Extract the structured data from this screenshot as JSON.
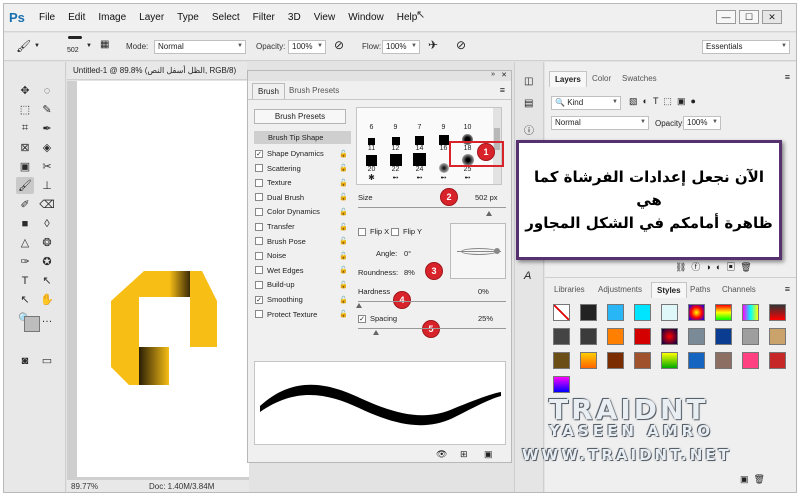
{
  "menubar": {
    "logo": "Ps",
    "items": [
      "File",
      "Edit",
      "Image",
      "Layer",
      "Type",
      "Select",
      "Filter",
      "3D",
      "View",
      "Window",
      "Help"
    ],
    "window_controls": {
      "minimize": "—",
      "restore": "☐",
      "close": "✕"
    }
  },
  "options": {
    "brush_size": "502",
    "mode_label": "Mode:",
    "mode_value": "Normal",
    "opacity_label": "Opacity:",
    "opacity_value": "100%",
    "flow_label": "Flow:",
    "flow_value": "100%",
    "workspace": "Essentials"
  },
  "document": {
    "tab_title": "Untitled-1 @ 89.8% (الظل أسفل النص, RGB/8)",
    "zoom": "89.77%",
    "doc_info": "Doc: 1.40M/3.84M"
  },
  "brush_panel": {
    "tabs": [
      "Brush",
      "Brush Presets"
    ],
    "presets_button": "Brush Presets",
    "tip_shape": "Brush Tip Shape",
    "options": [
      {
        "label": "Shape Dynamics",
        "checked": true
      },
      {
        "label": "Scattering",
        "checked": false
      },
      {
        "label": "Texture",
        "checked": false
      },
      {
        "label": "Dual Brush",
        "checked": false
      },
      {
        "label": "Color Dynamics",
        "checked": false
      },
      {
        "label": "Transfer",
        "checked": false
      },
      {
        "label": "Brush Pose",
        "checked": false
      },
      {
        "label": "Noise",
        "checked": false
      },
      {
        "label": "Wet Edges",
        "checked": false
      },
      {
        "label": "Build-up",
        "checked": false
      },
      {
        "label": "Smoothing",
        "checked": true
      },
      {
        "label": "Protect Texture",
        "checked": false
      }
    ],
    "tip_sizes_row1": [
      "6",
      "9",
      "7",
      "9",
      "10"
    ],
    "tip_sizes_row2": [
      "11",
      "12",
      "14",
      "16",
      "18"
    ],
    "tip_sizes_row3": [
      "20",
      "22",
      "24",
      "",
      "25"
    ],
    "size_label": "Size",
    "size_value": "502 px",
    "flip_x": "Flip X",
    "flip_y": "Flip Y",
    "angle_label": "Angle:",
    "angle_value": "0°",
    "roundness_label": "Roundness:",
    "roundness_value": "8%",
    "hardness_label": "Hardness",
    "hardness_value": "0%",
    "spacing_label": "Spacing",
    "spacing_value": "25%",
    "annotations": [
      "1",
      "2",
      "3",
      "4",
      "5"
    ]
  },
  "layers_panel": {
    "tabs": [
      "Layers",
      "Color",
      "Swatches"
    ],
    "kind": "Kind",
    "blend": "Normal",
    "opacity_label": "Opacity:",
    "opacity_value": "100%"
  },
  "styles_panel": {
    "tabs": [
      "Libraries",
      "Adjustments",
      "Styles",
      "Paths",
      "Channels"
    ]
  },
  "callout": {
    "line1": "الآن نجعل إعدادات الفرشاة كما هي",
    "line2": "ظاهرة أمامكم في الشكل المجاور"
  },
  "watermark": {
    "line1": "TRAIDNT",
    "line2": "YASEEN AMRO",
    "line3": "WWW.TRAIDNT.NET"
  },
  "colors": {
    "logo_yellow": "#f7be16",
    "annotation_red": "#d8232a",
    "callout_border": "#57306f",
    "ps_blue": "#1a6fb0"
  }
}
